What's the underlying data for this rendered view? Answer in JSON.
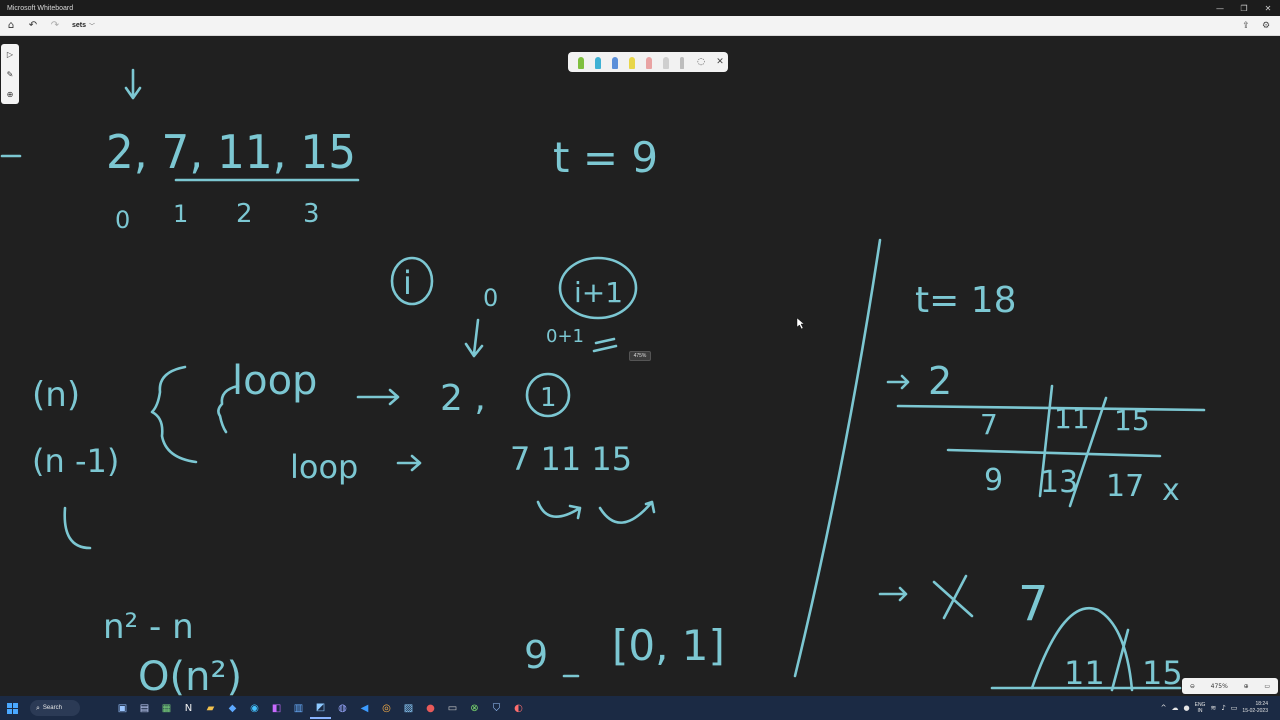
{
  "window": {
    "title": "Microsoft Whiteboard",
    "minimize": "—",
    "restore": "❐",
    "close": "✕"
  },
  "appbar": {
    "board_name": "sets",
    "home": "⌂",
    "undo": "↶",
    "redo": "↷",
    "share": "⇪",
    "settings": "⚙"
  },
  "sidetools": {
    "select": "▷",
    "ink": "✎",
    "insert": "⊕"
  },
  "pentray": {
    "lasso": "◌",
    "close": "✕"
  },
  "zoom": {
    "tooltip": "475%",
    "level": "475%",
    "zoom_out": "⊖",
    "zoom_in": "⊕",
    "fit": "▭"
  },
  "ink": {
    "color": "#7cc7d2",
    "array_values": "2, 7, 11, 15",
    "indices": [
      "0",
      "1",
      "2",
      "3"
    ],
    "target1": "t = 9",
    "i_label": "i",
    "i_zero": "0",
    "j_label": "i+1",
    "j_next": "0+1",
    "mark_one": "1",
    "n_label": "(n)",
    "n_minus_1": "(n -1)",
    "loop1": "loop",
    "loop2": "loop",
    "two": "2 ,",
    "seq": "7    11    15",
    "complexity1": "n² - n",
    "complexity2": "O(n²)",
    "result_t": "9",
    "result_arr": "[0, 1]",
    "target2": "t= 18",
    "r2": "2",
    "row1": [
      "7",
      "11",
      "15"
    ],
    "row2": [
      "9",
      "13",
      "17"
    ],
    "cross": "x",
    "seven": "7",
    "bottom_vals": [
      "11",
      "15"
    ]
  },
  "taskbar": {
    "search": "Search",
    "lang1": "ENG",
    "lang2": "IN",
    "time": "18:24",
    "date": "15-02-2023"
  }
}
